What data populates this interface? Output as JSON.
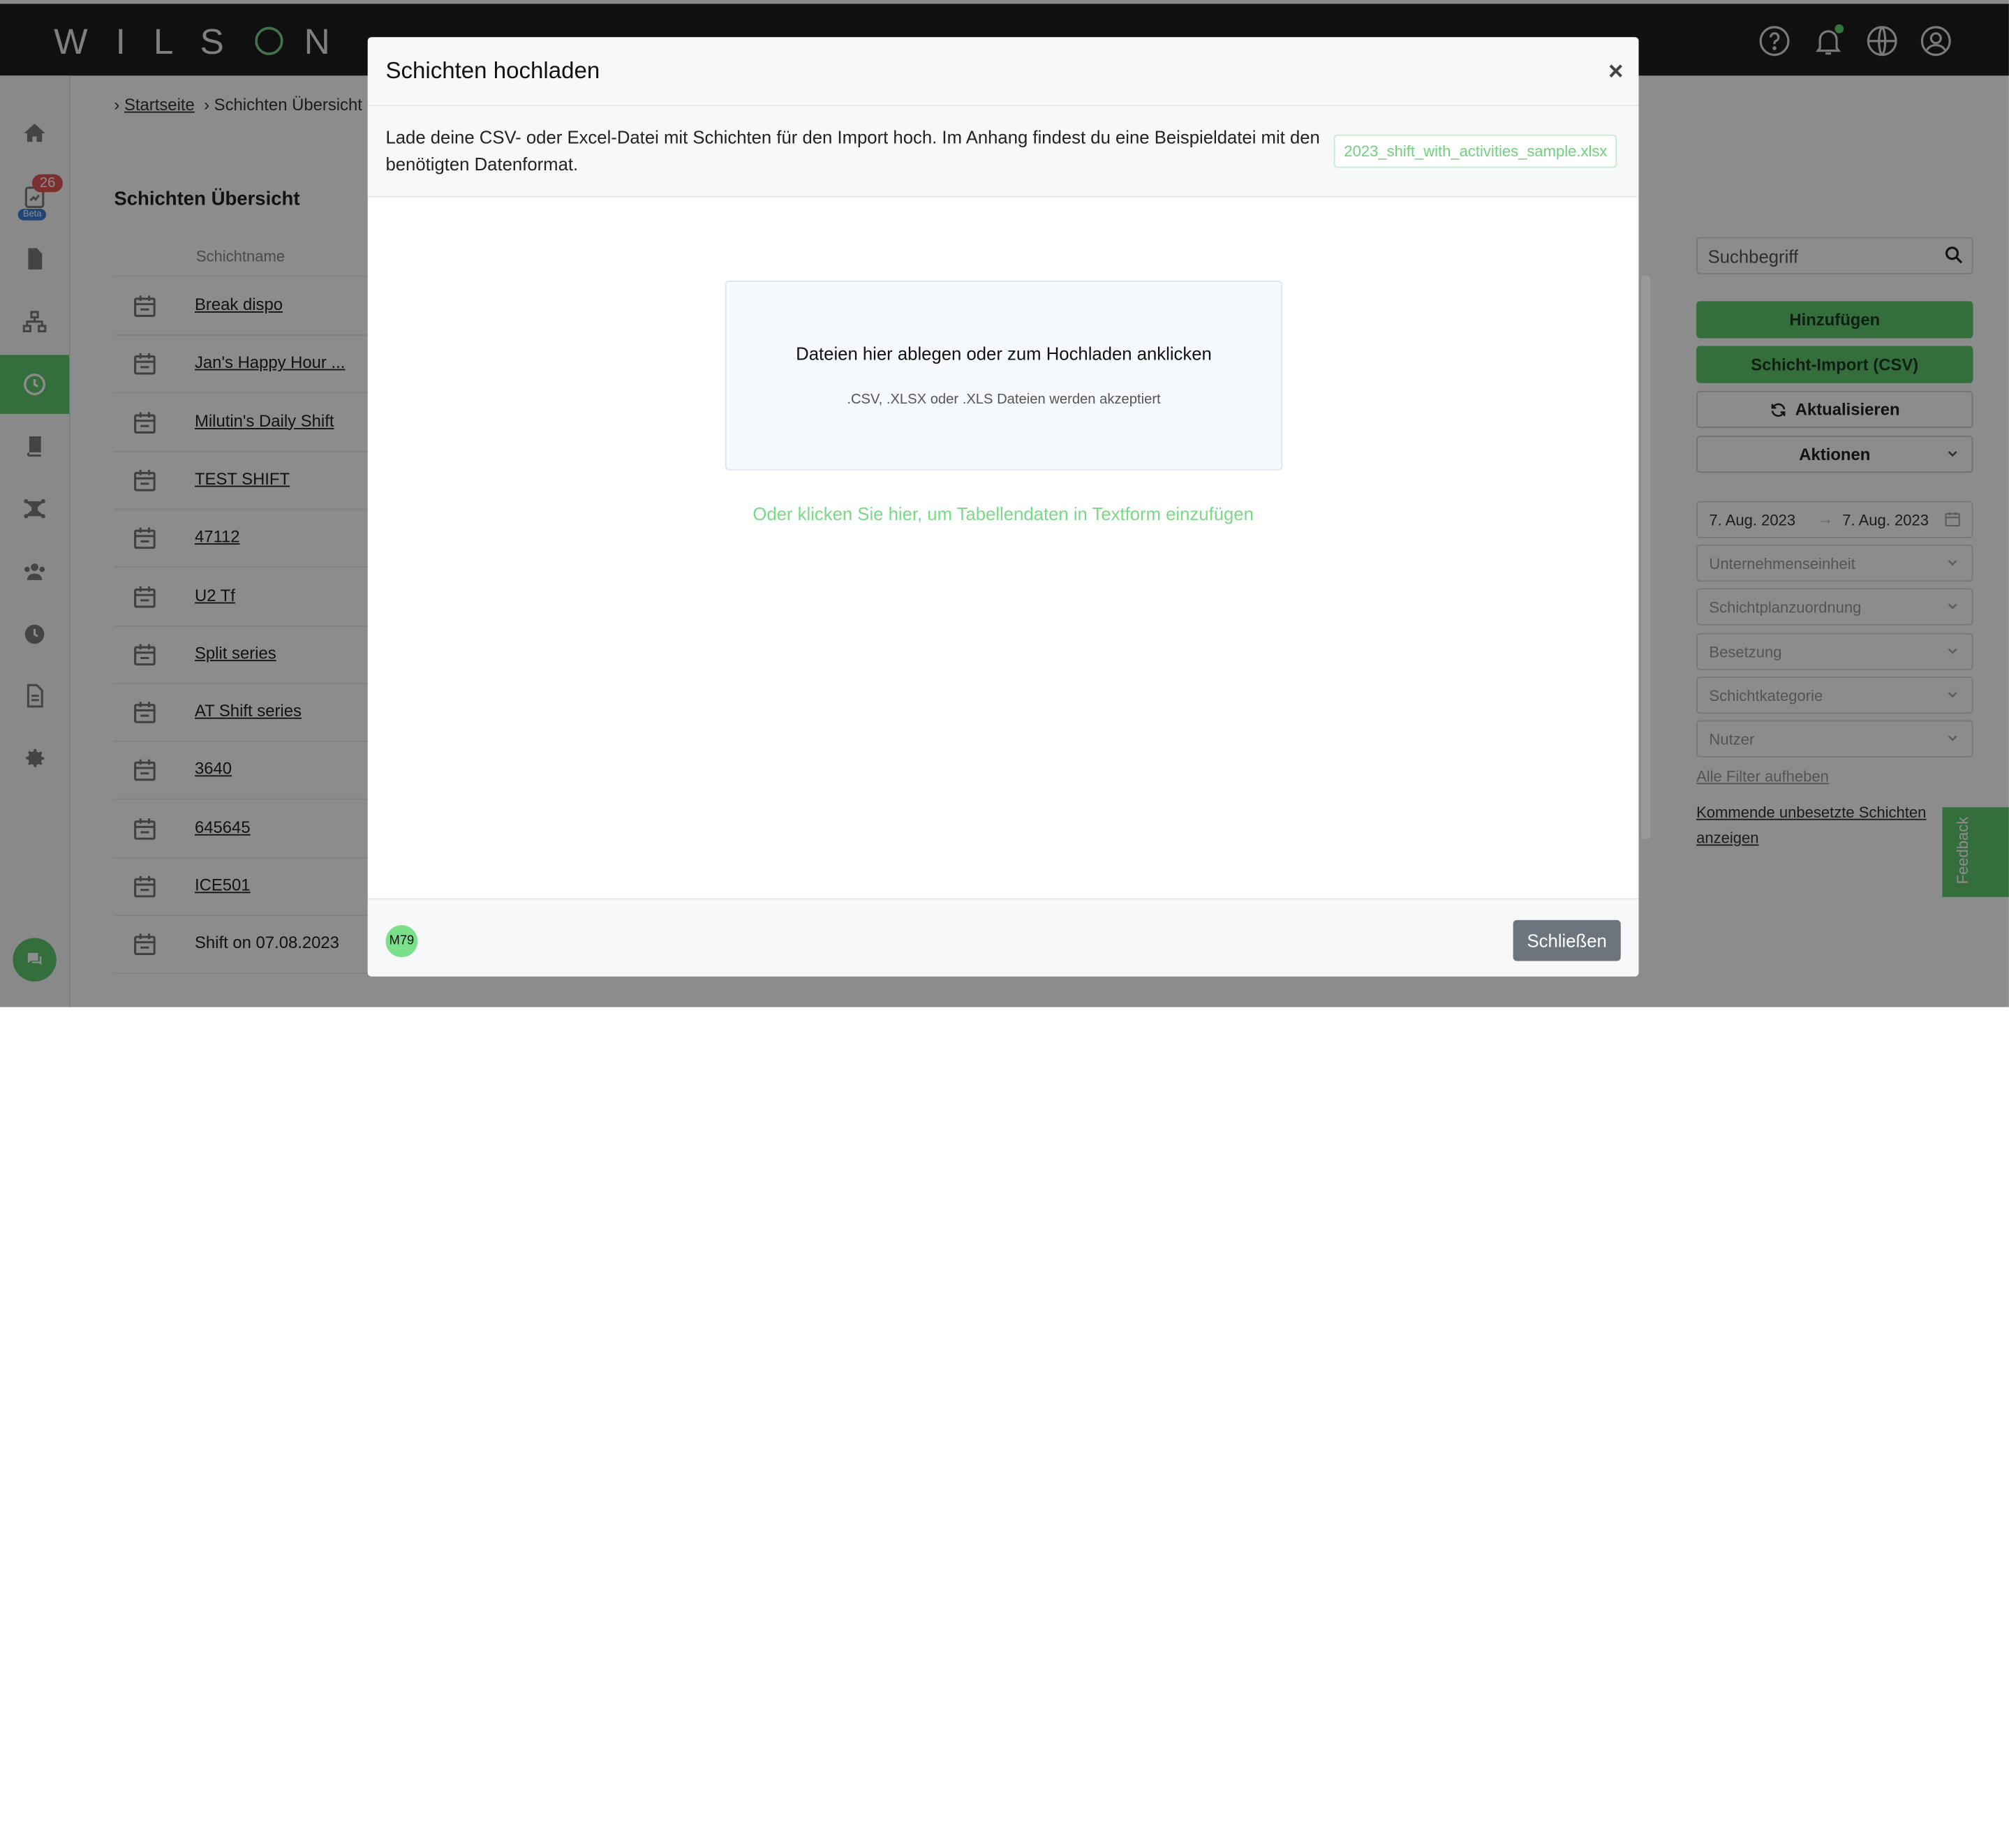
{
  "header": {
    "logo": "WILSON",
    "icons": [
      "help-icon",
      "bell-icon",
      "globe-icon",
      "user-icon"
    ]
  },
  "sidebar": {
    "badge_count": "26",
    "beta_label": "Beta",
    "items": [
      "home-icon",
      "reports-icon",
      "document-icon",
      "org-chart-icon",
      "clock-icon",
      "book-icon",
      "network-icon",
      "users-icon",
      "time-icon",
      "file-icon",
      "settings-icon"
    ]
  },
  "breadcrumb": {
    "home": "Startseite",
    "current": "Schichten Übersicht"
  },
  "page": {
    "title": "Schichten Übersicht",
    "column_header": "Schichtname"
  },
  "shifts": [
    "Break dispo",
    "Jan's Happy Hour ...",
    "Milutin's Daily Shift",
    "TEST SHIFT",
    "47112",
    "U2 Tf",
    "Split series",
    "AT Shift series",
    "3640",
    "645645",
    "ICE501",
    "Shift on 07.08.2023"
  ],
  "right_panel": {
    "search_placeholder": "Suchbegriff",
    "add_button": "Hinzufügen",
    "import_button": "Schicht-Import (CSV)",
    "refresh_button": "Aktualisieren",
    "actions_button": "Aktionen",
    "date_from": "7. Aug. 2023",
    "date_arrow": "→",
    "date_to": "7. Aug. 2023",
    "filters": [
      "Unternehmenseinheit",
      "Schichtplanzuordnung",
      "Besetzung",
      "Schichtkategorie",
      "Nutzer"
    ],
    "clear_filters": "Alle Filter aufheben",
    "upcoming_link": "Kommende unbesetzte Schichten anzeigen"
  },
  "feedback_label": "Feedback",
  "modal": {
    "title": "Schichten hochladen",
    "close_symbol": "×",
    "info_text": "Lade deine CSV- oder Excel-Datei mit Schichten für den Import hoch. Im Anhang findest du eine Beispieldatei mit den benötigten Datenformat.",
    "sample_file": "2023_shift_with_activities_sample.xlsx",
    "dropzone_title": "Dateien hier ablegen oder zum Hochladen anklicken",
    "dropzone_hint": ".CSV, .XLSX oder .XLS Dateien werden akzeptiert",
    "paste_link": "Oder klicken Sie hier, um Tabellendaten in Textform einzufügen",
    "avatar_initials": "M79",
    "close_button": "Schließen"
  },
  "colors": {
    "brand_green": "#5fc96d",
    "topbar": "#1e1e1e",
    "close_button": "#6c757d",
    "badge_red": "#e05656"
  }
}
